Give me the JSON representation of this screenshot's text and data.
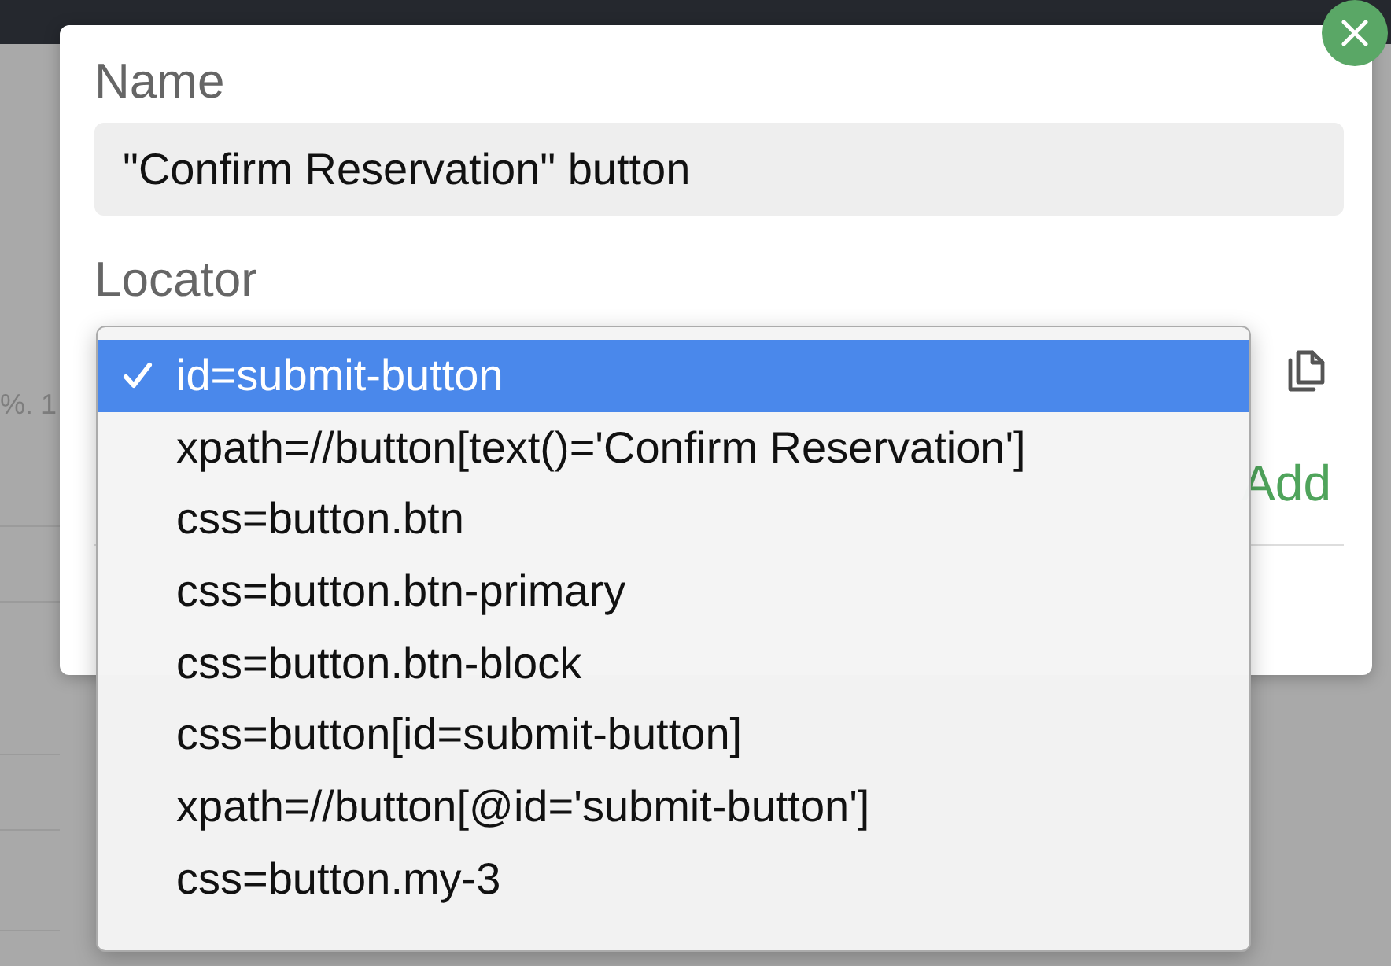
{
  "background": {
    "text_fragment": "%. 1"
  },
  "dialog": {
    "name": {
      "label": "Name",
      "value": "\"Confirm Reservation\" button"
    },
    "locator": {
      "label": "Locator",
      "options": [
        {
          "label": "id=submit-button",
          "selected": true
        },
        {
          "label": "xpath=//button[text()='Confirm Reservation']",
          "selected": false
        },
        {
          "label": "css=button.btn",
          "selected": false
        },
        {
          "label": "css=button.btn-primary",
          "selected": false
        },
        {
          "label": "css=button.btn-block",
          "selected": false
        },
        {
          "label": "css=button[id=submit-button]",
          "selected": false
        },
        {
          "label": "xpath=//button[@id='submit-button']",
          "selected": false
        },
        {
          "label": "css=button.my-3",
          "selected": false
        }
      ]
    },
    "add_action": "Add"
  }
}
